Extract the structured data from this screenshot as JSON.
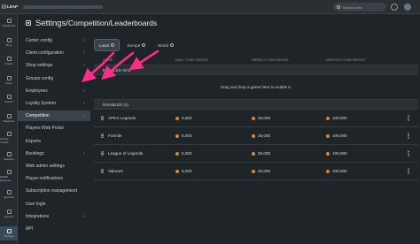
{
  "app": {
    "logo_text": "LEAP",
    "search_placeholder": "Search user"
  },
  "rail": [
    {
      "label": "Dashboard",
      "icon": "dashboard-icon"
    },
    {
      "label": "Shop",
      "icon": "shop-icon"
    },
    {
      "label": "Orders",
      "icon": "orders-icon"
    },
    {
      "label": "Users",
      "icon": "users-icon"
    },
    {
      "label": "Guests",
      "icon": "guests-icon"
    },
    {
      "label": "Bookings",
      "icon": "bookings-icon"
    },
    {
      "label": "Activity Tracker",
      "icon": "activity-icon"
    },
    {
      "label": "Statistics",
      "icon": "statistics-icon"
    },
    {
      "label": "GDPR Requests",
      "icon": "gdpr-icon"
    },
    {
      "label": "ggCircuit",
      "icon": "circuit-icon"
    },
    {
      "label": "Discord",
      "icon": "discord-icon"
    },
    {
      "label": "Settings",
      "icon": "settings-icon",
      "active": true
    }
  ],
  "header": {
    "title_prefix": "Settings/",
    "title_rest": "Competition/Leaderboards"
  },
  "menu": [
    {
      "label": "Center config",
      "chevron": true
    },
    {
      "label": "Client configuration",
      "chevron": true
    },
    {
      "label": "Shop settings",
      "chevron": true
    },
    {
      "label": "Groups config",
      "chevron": true
    },
    {
      "label": "Employees",
      "chevron": true
    },
    {
      "label": "Loyalty System",
      "chevron": true
    },
    {
      "label": "Competition",
      "chevron": true,
      "active": true
    },
    {
      "label": "Players Web Portal",
      "chevron": false
    },
    {
      "label": "Exports",
      "chevron": false
    },
    {
      "label": "Bookings",
      "chevron": true
    },
    {
      "label": "Web admin settings",
      "chevron": false
    },
    {
      "label": "Player notifications",
      "chevron": false
    },
    {
      "label": "Subscription management",
      "chevron": false
    },
    {
      "label": "User login",
      "chevron": false
    },
    {
      "label": "Integrations",
      "chevron": true
    },
    {
      "label": "API",
      "chevron": false
    }
  ],
  "tabs": [
    {
      "label": "Local",
      "active": true
    },
    {
      "label": "Europe",
      "active": false
    },
    {
      "label": "World",
      "active": false
    }
  ],
  "table": {
    "headers": [
      "GAME",
      "DAILY COIN PAYOUT",
      "WEEKLY COIN PAYOUT",
      "MONTHLY COIN PAYOUT"
    ],
    "enabled_label": "ENABLED (0/4)",
    "drop_text": "Drag and drop a game here to enable it.",
    "disabled_label": "DISABLED (4)",
    "rows": [
      {
        "game": "APEX Legends",
        "daily": "5,000",
        "weekly": "25,000",
        "monthly": "100,000"
      },
      {
        "game": "Fortnite",
        "daily": "5,000",
        "weekly": "25,000",
        "monthly": "100,000"
      },
      {
        "game": "League of Legends",
        "daily": "5,000",
        "weekly": "25,000",
        "monthly": "100,000"
      },
      {
        "game": "Valorant",
        "daily": "5,000",
        "weekly": "25,000",
        "monthly": "100,000"
      }
    ]
  },
  "colors": {
    "accent_arrow": "#ff2d87",
    "coin": "#d9892a"
  }
}
